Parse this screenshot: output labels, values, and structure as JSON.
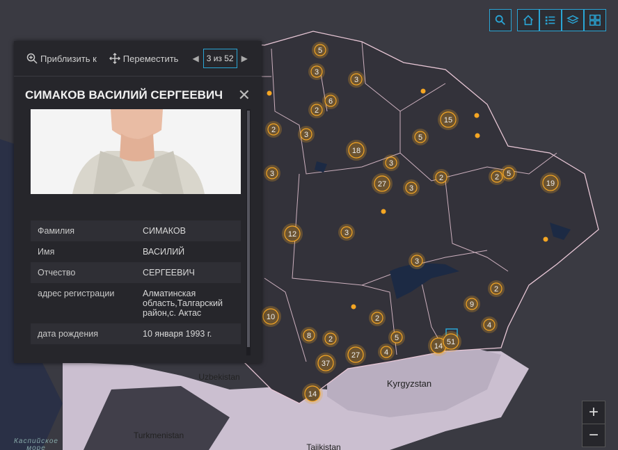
{
  "map": {
    "countries": {
      "uzbekistan": "Uzbekistan",
      "kyrgyzstan": "Kyrgyzstan",
      "turkmenistan": "Turkmenistan",
      "tajikistan": "Tajikistan"
    },
    "sea_label_1": "Каспийское",
    "sea_label_2": "море",
    "clusters": [
      "5",
      "3",
      "3",
      "6",
      "2",
      "2",
      "3",
      "15",
      "5",
      "18",
      "3",
      "2",
      "27",
      "3",
      "2",
      "5",
      "19",
      "3",
      "12",
      "3",
      "3",
      "10",
      "8",
      "2",
      "2",
      "9",
      "2",
      "5",
      "4",
      "4",
      "14",
      "51",
      "37",
      "27",
      "14"
    ]
  },
  "toolbar": {
    "search": "search-icon",
    "home": "home-icon",
    "list": "list-icon",
    "layers": "layers-icon",
    "basemap": "basemap-gallery-icon"
  },
  "popup": {
    "zoom_label": "Приблизить к",
    "move_label": "Переместить",
    "pager": "3 из 52",
    "title": "СИМАКОВ ВАСИЛИЙ СЕРГЕЕВИЧ",
    "fields": [
      {
        "key": "Фамилия",
        "value": "СИМАКОВ"
      },
      {
        "key": "Имя",
        "value": "ВАСИЛИЙ"
      },
      {
        "key": "Отчество",
        "value": "СЕРГЕЕВИЧ"
      },
      {
        "key": "адрес регистрации",
        "value": "Алматинская область,Талгарский район,с. Актас"
      },
      {
        "key": "дата рождения",
        "value": "10 января 1993 г."
      }
    ]
  },
  "zoom": {
    "in": "+",
    "out": "−"
  },
  "colors": {
    "accent": "#2aa6d6",
    "cluster": "#f5a623",
    "border": "#e8c7d6"
  }
}
